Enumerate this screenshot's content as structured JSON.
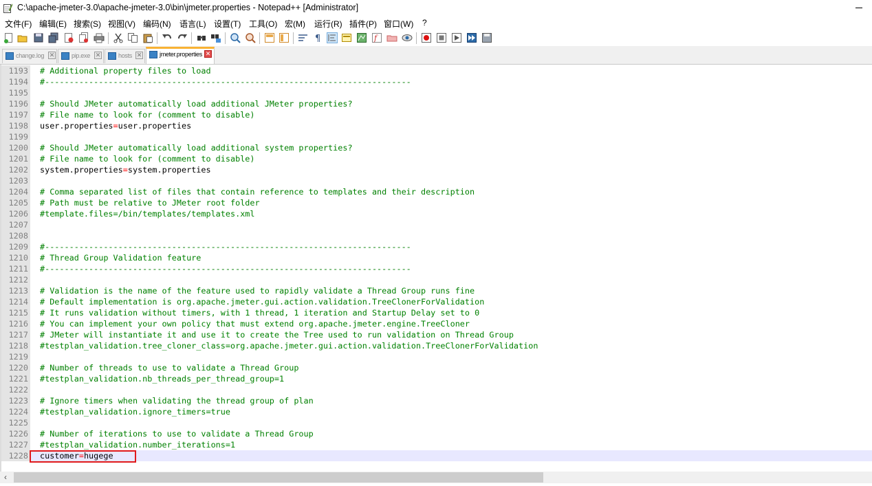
{
  "window": {
    "title": "C:\\apache-jmeter-3.0\\apache-jmeter-3.0\\bin\\jmeter.properties - Notepad++ [Administrator]"
  },
  "menu": [
    {
      "label": "文件(F)"
    },
    {
      "label": "编辑(E)"
    },
    {
      "label": "搜索(S)"
    },
    {
      "label": "视图(V)"
    },
    {
      "label": "编码(N)"
    },
    {
      "label": "语言(L)"
    },
    {
      "label": "设置(T)"
    },
    {
      "label": "工具(O)"
    },
    {
      "label": "宏(M)"
    },
    {
      "label": "运行(R)"
    },
    {
      "label": "插件(P)"
    },
    {
      "label": "窗口(W)"
    },
    {
      "label": "?"
    }
  ],
  "toolbar_icons": [
    "new-file-icon",
    "open-file-icon",
    "save-icon",
    "save-all-icon",
    "close-icon",
    "close-all-icon",
    "print-icon",
    "cut-icon",
    "copy-icon",
    "paste-icon",
    "undo-icon",
    "redo-icon",
    "find-icon",
    "replace-icon",
    "zoom-in-icon",
    "zoom-out-icon",
    "sync-vertical-icon",
    "sync-horizontal-icon",
    "word-wrap-icon",
    "show-all-chars-icon",
    "indent-guide-icon",
    "language-icon",
    "document-map-icon",
    "function-list-icon",
    "folder-icon",
    "monitor-icon",
    "record-macro-icon",
    "stop-macro-icon",
    "play-macro-icon",
    "run-macro-multiple-icon",
    "save-macro-icon"
  ],
  "tabs": [
    {
      "label": "change.log",
      "active": false
    },
    {
      "label": "pip.exe",
      "active": false
    },
    {
      "label": "hosts",
      "active": false
    },
    {
      "label": "jmeter.properties",
      "active": true
    }
  ],
  "colors": {
    "comment": "#008000",
    "operator": "#ff0000",
    "current_line": "#e8e8ff",
    "active_tab_accent": "#f9b233",
    "highlight_box": "#e0191b"
  },
  "lines": [
    {
      "n": "1193",
      "type": "comment",
      "text": "# Additional property files to load"
    },
    {
      "n": "1194",
      "type": "comment",
      "text": "#---------------------------------------------------------------------------"
    },
    {
      "n": "1195",
      "type": "blank",
      "text": ""
    },
    {
      "n": "1196",
      "type": "comment",
      "text": "# Should JMeter automatically load additional JMeter properties?"
    },
    {
      "n": "1197",
      "type": "comment",
      "text": "# File name to look for (comment to disable)"
    },
    {
      "n": "1198",
      "type": "kv",
      "key": "user.properties",
      "op": "=",
      "val": "user.properties"
    },
    {
      "n": "1199",
      "type": "blank",
      "text": ""
    },
    {
      "n": "1200",
      "type": "comment",
      "text": "# Should JMeter automatically load additional system properties?"
    },
    {
      "n": "1201",
      "type": "comment",
      "text": "# File name to look for (comment to disable)"
    },
    {
      "n": "1202",
      "type": "kv",
      "key": "system.properties",
      "op": "=",
      "val": "system.properties"
    },
    {
      "n": "1203",
      "type": "blank",
      "text": ""
    },
    {
      "n": "1204",
      "type": "comment",
      "text": "# Comma separated list of files that contain reference to templates and their description"
    },
    {
      "n": "1205",
      "type": "comment",
      "text": "# Path must be relative to JMeter root folder"
    },
    {
      "n": "1206",
      "type": "comment",
      "text": "#template.files=/bin/templates/templates.xml"
    },
    {
      "n": "1207",
      "type": "blank",
      "text": ""
    },
    {
      "n": "1208",
      "type": "blank",
      "text": ""
    },
    {
      "n": "1209",
      "type": "comment",
      "text": "#---------------------------------------------------------------------------"
    },
    {
      "n": "1210",
      "type": "comment",
      "text": "# Thread Group Validation feature"
    },
    {
      "n": "1211",
      "type": "comment",
      "text": "#---------------------------------------------------------------------------"
    },
    {
      "n": "1212",
      "type": "blank",
      "text": ""
    },
    {
      "n": "1213",
      "type": "comment",
      "text": "# Validation is the name of the feature used to rapidly validate a Thread Group runs fine"
    },
    {
      "n": "1214",
      "type": "comment",
      "text": "# Default implementation is org.apache.jmeter.gui.action.validation.TreeClonerForValidation"
    },
    {
      "n": "1215",
      "type": "comment",
      "text": "# It runs validation without timers, with 1 thread, 1 iteration and Startup Delay set to 0"
    },
    {
      "n": "1216",
      "type": "comment",
      "text": "# You can implement your own policy that must extend org.apache.jmeter.engine.TreeCloner"
    },
    {
      "n": "1217",
      "type": "comment",
      "text": "# JMeter will instantiate it and use it to create the Tree used to run validation on Thread Group"
    },
    {
      "n": "1218",
      "type": "comment",
      "text": "#testplan_validation.tree_cloner_class=org.apache.jmeter.gui.action.validation.TreeClonerForValidation"
    },
    {
      "n": "1219",
      "type": "blank",
      "text": ""
    },
    {
      "n": "1220",
      "type": "comment",
      "text": "# Number of threads to use to validate a Thread Group"
    },
    {
      "n": "1221",
      "type": "comment",
      "text": "#testplan_validation.nb_threads_per_thread_group=1"
    },
    {
      "n": "1222",
      "type": "blank",
      "text": ""
    },
    {
      "n": "1223",
      "type": "comment",
      "text": "# Ignore timers when validating the thread group of plan"
    },
    {
      "n": "1224",
      "type": "comment",
      "text": "#testplan_validation.ignore_timers=true"
    },
    {
      "n": "1225",
      "type": "blank",
      "text": ""
    },
    {
      "n": "1226",
      "type": "comment",
      "text": "# Number of iterations to use to validate a Thread Group"
    },
    {
      "n": "1227",
      "type": "comment",
      "text": "#testplan_validation.number_iterations=1"
    },
    {
      "n": "1228",
      "type": "kv",
      "key": "customer",
      "op": "=",
      "val": "hugege",
      "current": true
    }
  ]
}
